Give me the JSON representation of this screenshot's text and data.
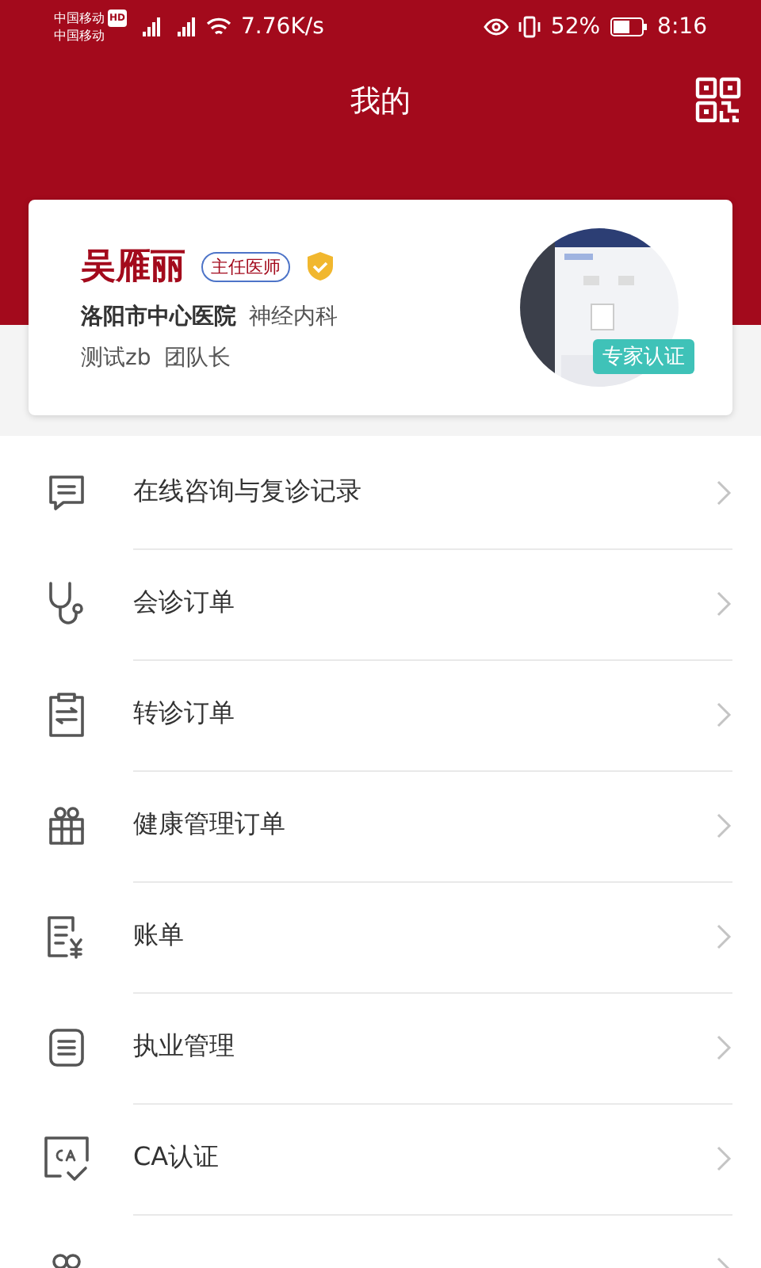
{
  "status_bar": {
    "carriers": [
      "中国移动",
      "中国移动"
    ],
    "hd_badge": "HD",
    "speed": "7.76K/s",
    "battery_percent": "52%",
    "time": "8:16"
  },
  "header": {
    "title": "我的"
  },
  "profile": {
    "name": "吴雁丽",
    "title_badge": "主任医师",
    "verified": true,
    "hospital": "洛阳市中心医院",
    "department": "神经内科",
    "team": "测试zb",
    "role": "团队长",
    "cert_badge": "专家认证"
  },
  "menu": [
    {
      "kind": "full",
      "label": "在线咨询与复诊记录"
    },
    {
      "kind": "full",
      "label": "会诊订单"
    },
    {
      "kind": "full",
      "label": "转诊订单"
    },
    {
      "kind": "full",
      "label": "健康管理订单"
    },
    {
      "kind": "full",
      "label": "账单"
    },
    {
      "kind": "full",
      "label": "执业管理"
    },
    {
      "kind": "full",
      "label": "CA认证"
    },
    {
      "kind": "cut"
    }
  ]
}
